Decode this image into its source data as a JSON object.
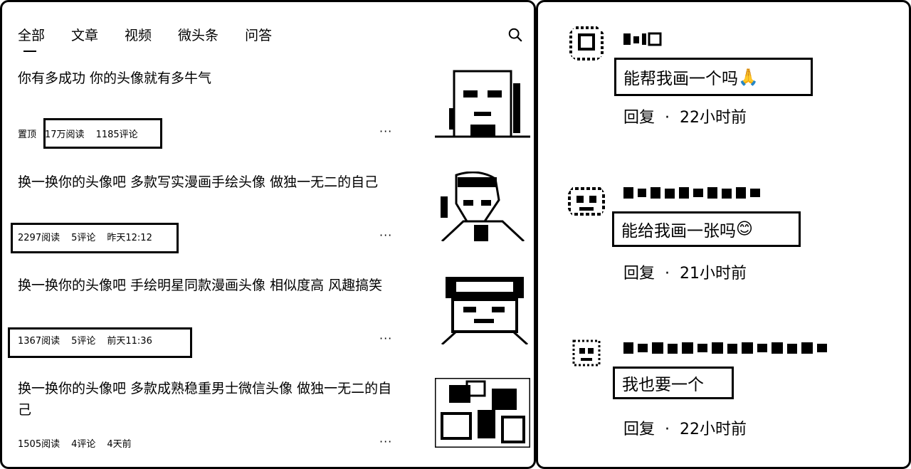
{
  "tabs": [
    {
      "label": "全部"
    },
    {
      "label": "文章"
    },
    {
      "label": "视频"
    },
    {
      "label": "微头条"
    },
    {
      "label": "问答"
    }
  ],
  "icons": {
    "search": "search-icon",
    "more": "more-icon"
  },
  "articles": [
    {
      "title": "你有多成功 你的头像就有多牛气",
      "meta": [
        "置顶",
        "17万阅读",
        "1185评论"
      ],
      "more": "···"
    },
    {
      "title": "换一换你的头像吧 多款写实漫画手绘头像 做独一无二的自己",
      "meta": [
        "2297阅读",
        "5评论",
        "昨天12:12"
      ],
      "more": "···"
    },
    {
      "title": "换一换你的头像吧 手绘明星同款漫画头像 相似度高 风趣搞笑",
      "meta": [
        "1367阅读",
        "5评论",
        "前天11:36"
      ],
      "more": "···"
    },
    {
      "title": "换一换你的头像吧 多款成熟稳重男士微信头像 做独一无二的自己",
      "meta": [
        "1505阅读",
        "4评论",
        "4天前"
      ],
      "more": "···"
    }
  ],
  "comments": [
    {
      "text": "能帮我画一个吗",
      "emoji": "🙏",
      "reply": "回复",
      "dot": "·",
      "time": "22小时前"
    },
    {
      "text": "能给我画一张吗",
      "emoji": "😊",
      "reply": "回复",
      "dot": "·",
      "time": "21小时前"
    },
    {
      "text": "我也要一个",
      "emoji": "",
      "reply": "回复",
      "dot": "·",
      "time": "22小时前"
    }
  ]
}
